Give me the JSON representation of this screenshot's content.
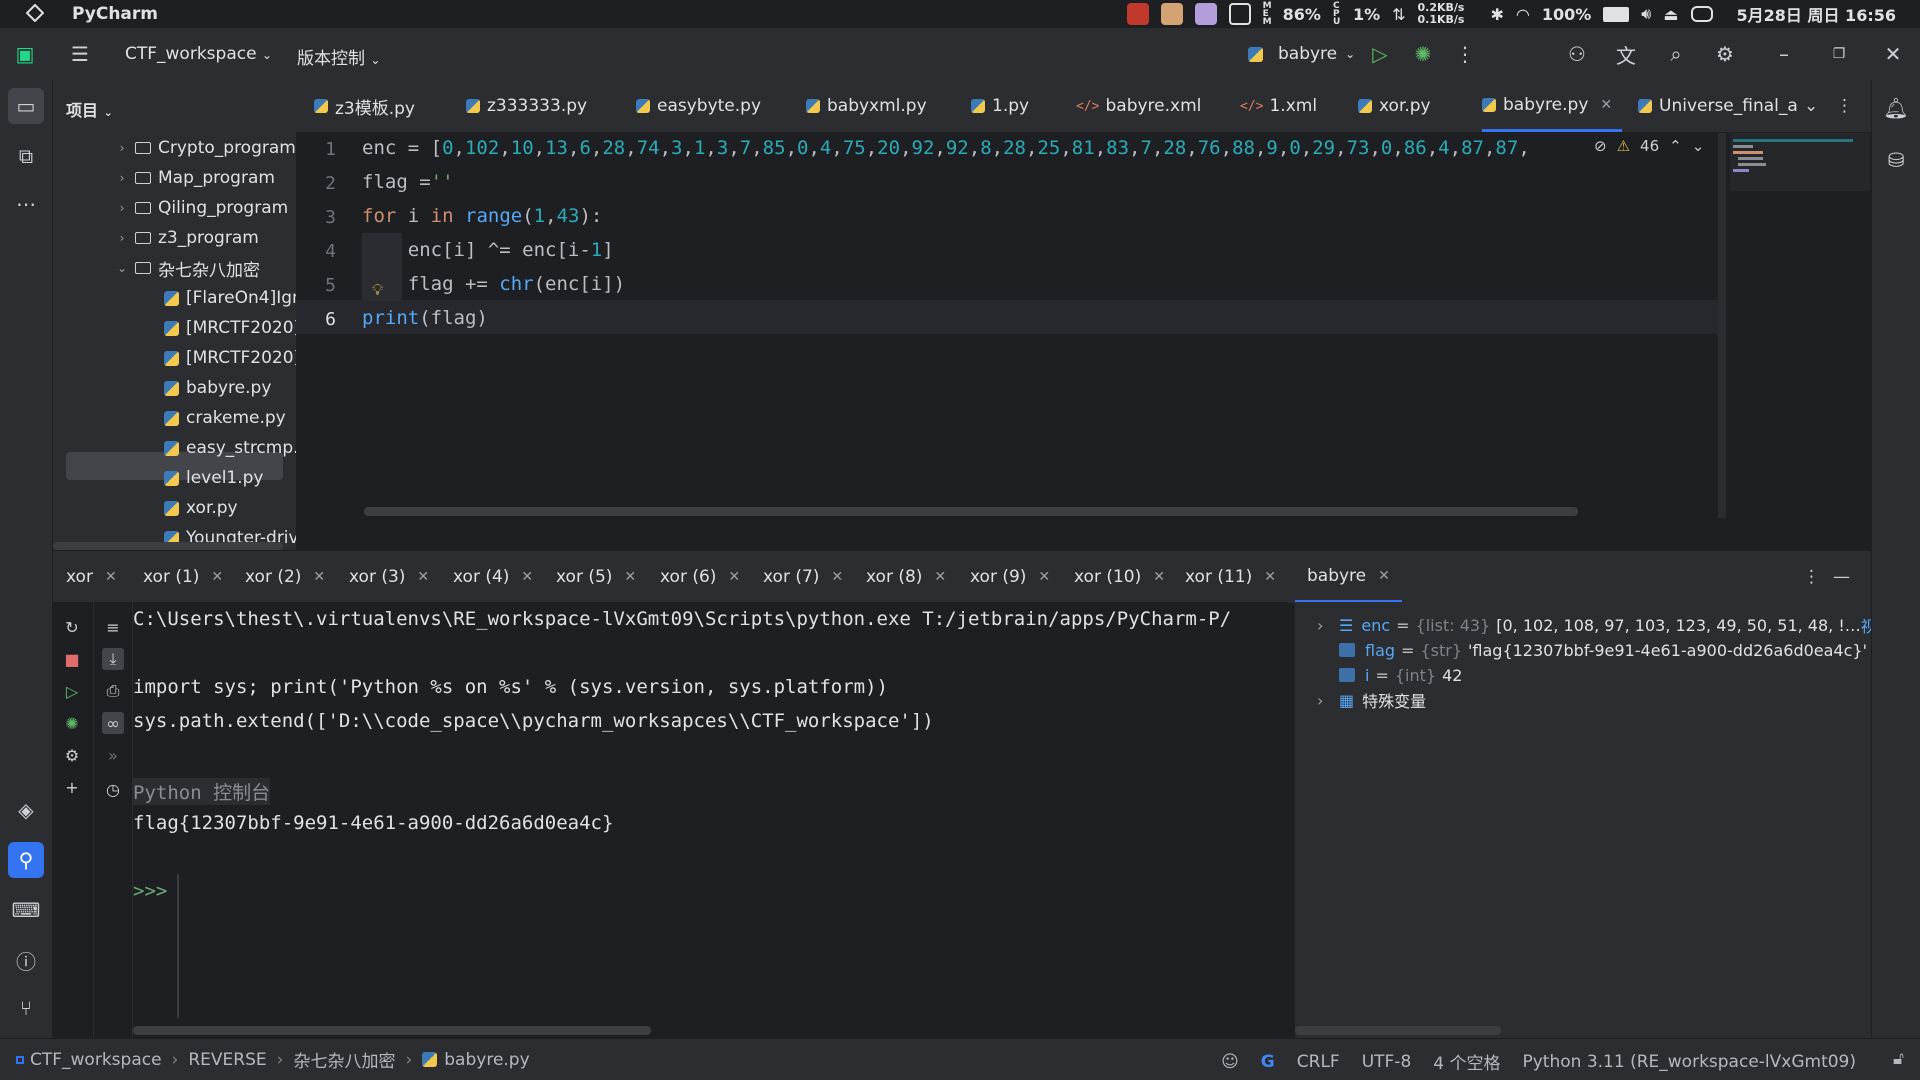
{
  "system": {
    "app_name": "PyCharm",
    "mem_label": "M E M",
    "mem": "86%",
    "cpu_label": "C P U",
    "cpu": "1%",
    "net_up": "0.2KB/s",
    "net_down": "0.1KB/s",
    "battery": "100%",
    "datetime": "5月28日 周日 16:56"
  },
  "toolbar": {
    "project": "CTF_workspace",
    "vcs": "版本控制",
    "run_config": "babyre"
  },
  "project_panel": {
    "title": "项目",
    "items": [
      {
        "label": "Crypto_program",
        "type": "folder"
      },
      {
        "label": "Map_program",
        "type": "folder"
      },
      {
        "label": "Qiling_program",
        "type": "folder"
      },
      {
        "label": "z3_program",
        "type": "folder"
      },
      {
        "label": "杂七杂八加密",
        "type": "folder-open"
      },
      {
        "label": "[FlareOn4]Ign",
        "type": "py"
      },
      {
        "label": "[MRCTF2020]",
        "type": "py"
      },
      {
        "label": "[MRCTF2020]",
        "type": "py"
      },
      {
        "label": "babyre.py",
        "type": "py",
        "selected": true
      },
      {
        "label": "crakeme.py",
        "type": "py"
      },
      {
        "label": "easy_strcmp.p",
        "type": "py"
      },
      {
        "label": "level1.py",
        "type": "py"
      },
      {
        "label": "xor.py",
        "type": "py"
      },
      {
        "label": "Youngter-driv",
        "type": "py"
      }
    ]
  },
  "editor_tabs": [
    {
      "label": "z3模板.py",
      "icon": "py"
    },
    {
      "label": "z333333.py",
      "icon": "py"
    },
    {
      "label": "easybyte.py",
      "icon": "py"
    },
    {
      "label": "babyxml.py",
      "icon": "py"
    },
    {
      "label": "1.py",
      "icon": "py"
    },
    {
      "label": "babyre.xml",
      "icon": "xml"
    },
    {
      "label": "1.xml",
      "icon": "xml"
    },
    {
      "label": "xor.py",
      "icon": "py"
    },
    {
      "label": "babyre.py",
      "icon": "py",
      "active": true
    },
    {
      "label": "Universe_final_a",
      "icon": "py"
    }
  ],
  "editor": {
    "warnings": "46",
    "line_numbers": [
      "1",
      "2",
      "3",
      "4",
      "5",
      "6"
    ],
    "lines": [
      "enc = [0,102,10,13,6,28,74,3,1,3,7,85,0,4,75,20,92,92,8,28,25,81,83,7,28,76,88,9,0,29,73,0,86,4,87,87,",
      "flag =''",
      "for i in range(1,43):",
      "    enc[i] ^= enc[i-1]",
      "    flag += chr(enc[i])",
      "print(flag)"
    ]
  },
  "bottom_tabs": [
    "xor",
    "xor (1)",
    "xor (2)",
    "xor (3)",
    "xor (4)",
    "xor (5)",
    "xor (6)",
    "xor (7)",
    "xor (8)",
    "xor (9)",
    "xor (10)",
    "xor (11)",
    "babyre"
  ],
  "console": {
    "lines": [
      "C:\\Users\\thest\\.virtualenvs\\RE_workspace-lVxGmt09\\Scripts\\python.exe T:/jetbrain/apps/PyCharm-P/",
      "",
      "import sys; print('Python %s on %s' % (sys.version, sys.platform))",
      "sys.path.extend(['D:\\\\code_space\\\\pycharm_worksapces\\\\CTF_workspace'])",
      "",
      "Python 控制台",
      "flag{12307bbf-9e91-4e61-a900-dd26a6d0ea4c}"
    ],
    "prompt": ">>>"
  },
  "variables": [
    {
      "name": "enc",
      "eq": "=",
      "type": "{list: 43}",
      "value": "[0, 102, 108, 97, 103, 123, 49, 50, 51, 48, !…",
      "link": "视图",
      "expandable": true
    },
    {
      "name": "flag",
      "eq": "=",
      "type": "{str}",
      "value": "'flag{12307bbf-9e91-4e61-a900-dd26a6d0ea4c}'",
      "expandable": false
    },
    {
      "name": "i",
      "eq": "=",
      "type": "{int}",
      "value": "42",
      "expandable": false
    },
    {
      "name": "特殊变量",
      "eq": "",
      "type": "",
      "value": "",
      "expandable": true
    }
  ],
  "status": {
    "breadcrumbs": [
      "CTF_workspace",
      "REVERSE",
      "杂七杂八加密",
      "babyre.py"
    ],
    "line_sep": "CRLF",
    "encoding": "UTF-8",
    "indent": "4 个空格",
    "interpreter": "Python 3.11 (RE_workspace-lVxGmt09)"
  },
  "colors": {
    "accent": "#3574f0",
    "background": "#1e1f22",
    "panel": "#2b2d30"
  }
}
